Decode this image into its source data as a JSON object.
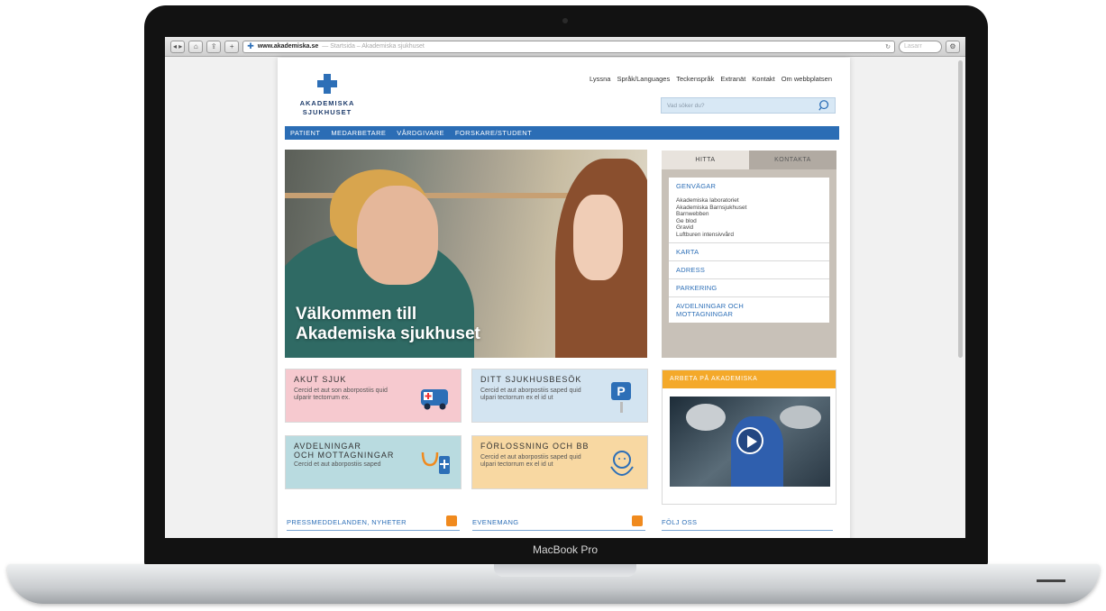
{
  "device": {
    "label": "MacBook Pro"
  },
  "browser": {
    "url_domain": "www.akademiska.se",
    "url_title": "— Startsida – Akademiska sjukhuset",
    "search_placeholder": "Lasarr"
  },
  "site": {
    "logo_line1": "AKADEMISKA",
    "logo_line2": "SJUKHUSET",
    "top_links": [
      "Lyssna",
      "Språk/Languages",
      "Teckenspråk",
      "Extranät",
      "Kontakt",
      "Om webbplatsen"
    ],
    "search_placeholder": "Vad söker du?",
    "nav": [
      "PATIENT",
      "MEDARBETARE",
      "VÅRDGIVARE",
      "FORSKARE/STUDENT"
    ],
    "hero_line1": "Välkommen till",
    "hero_line2": "Akademiska sjukhuset",
    "side_tabs": [
      "HITTA",
      "KONTAKTA"
    ],
    "genvagar_title": "GENVÄGAR",
    "genvagar_items": [
      "Akademiska laboratoriet",
      "Akademiska Barnsjukhuset",
      "Barnwebben",
      "Ge blod",
      "Gravid",
      "Luftburen intensivvård"
    ],
    "side_links": [
      "KARTA",
      "ADRESS",
      "PARKERING",
      "AVDELNINGAR OCH MOTTAGNINGAR"
    ],
    "boxes": [
      {
        "title": "AKUT SJUK",
        "text": "Cercid et aut son aborpostiis quid ulparir tectorrum ex."
      },
      {
        "title": "DITT SJUKHUSBESÖK",
        "text": "Cercid et aut aborpostiis saped quid ulpari tectorrum ex el id ut"
      },
      {
        "title_line1": "AVDELNINGAR",
        "title_line2": "OCH MOTTAGNINGAR",
        "text": "Cercid et aut aborpostiis saped"
      },
      {
        "title": "FÖRLOSSNING OCH BB",
        "text": "Cercid et aut aborpostiis saped quid ulpari tectorrum ex el id ut"
      }
    ],
    "jobs_title": "ARBETA PÅ AKADEMISKA",
    "footer_heads": [
      "PRESSMEDDELANDEN, NYHETER",
      "EVENEMANG",
      "FÖLJ OSS"
    ]
  },
  "colors": {
    "brand_blue": "#2b6db5",
    "orange": "#f4a92a",
    "akut_pink": "#f6c9cf"
  }
}
